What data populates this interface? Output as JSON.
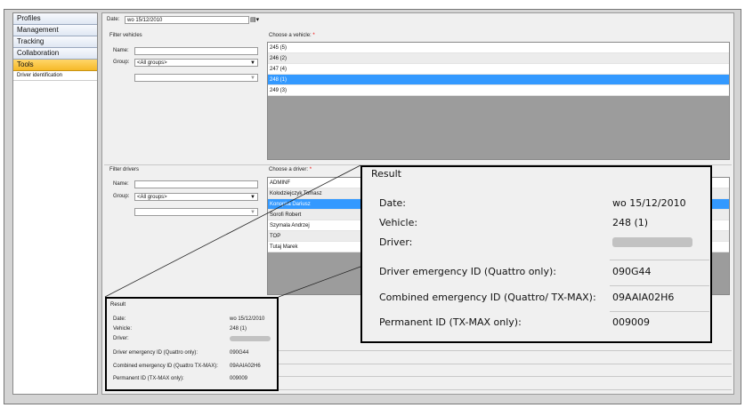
{
  "sidebar": {
    "items": [
      {
        "label": "Profiles",
        "active": false
      },
      {
        "label": "Management",
        "active": false
      },
      {
        "label": "Tracking",
        "active": false
      },
      {
        "label": "Collaboration",
        "active": false
      },
      {
        "label": "Tools",
        "active": true
      }
    ],
    "sub_item": "Driver identification"
  },
  "date": {
    "label": "Date:",
    "value": "wo 15/12/2010"
  },
  "filter_vehicles": {
    "title": "Filter vehicles",
    "name_label": "Name:",
    "name_value": "",
    "group_label": "Group:",
    "group_value": "<All groups>",
    "subgroup_value": ""
  },
  "choose_vehicle": {
    "label": "Choose a vehicle:",
    "required": "*",
    "items": [
      "245 (5)",
      "246 (2)",
      "247 (4)",
      "248 (1)",
      "249 (3)"
    ],
    "selected_index": 3
  },
  "filter_drivers": {
    "title": "Filter drivers",
    "name_label": "Name:",
    "name_value": "",
    "group_label": "Group:",
    "group_value": "<All groups>",
    "subgroup_value": ""
  },
  "choose_driver": {
    "label": "Choose a driver:",
    "required": "*",
    "items": [
      "ADMINF",
      "Kołodziejczyk Tomasz",
      "Konopka Dariusz",
      "Sorofi Robert",
      "Szymala Andrzej",
      "TOP",
      "Tutaj Marek"
    ],
    "selected_index": 2
  },
  "result": {
    "title": "Result",
    "date_label": "Date:",
    "date_value": "wo 15/12/2010",
    "vehicle_label": "Vehicle:",
    "vehicle_value": "248 (1)",
    "driver_label": "Driver:",
    "emergency_label": "Driver emergency ID (Quattro only):",
    "emergency_value": "090G44",
    "combined_label": "Combined emergency ID (Quattro/ TX-MAX):",
    "combined_label_small": "Combined emergency ID (Quattro  TX-MAX):",
    "combined_value": "09AAIA02H6",
    "permanent_label": "Permanent ID (TX-MAX only):",
    "permanent_value": "009009"
  }
}
